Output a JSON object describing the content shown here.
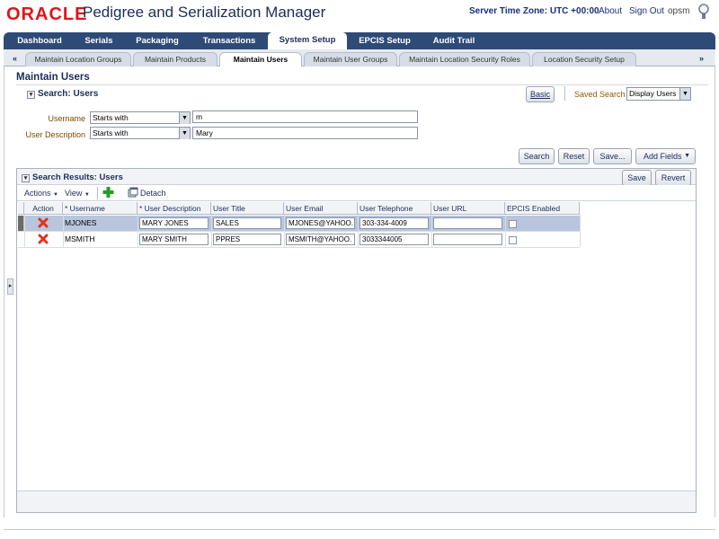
{
  "header": {
    "logo_text": "ORACLE",
    "app_title": "Pedigree and Serialization Manager",
    "server_time": "Server Time Zone: UTC +00:00",
    "about": "About",
    "sign_out": "Sign Out",
    "user": "opsm"
  },
  "main_tabs": [
    {
      "label": "Dashboard",
      "active": false
    },
    {
      "label": "Serials",
      "active": false
    },
    {
      "label": "Packaging",
      "active": false
    },
    {
      "label": "Transactions",
      "active": false
    },
    {
      "label": "System Setup",
      "active": true
    },
    {
      "label": "EPCIS Setup",
      "active": false
    },
    {
      "label": "Audit Trail",
      "active": false
    }
  ],
  "sub_tabs": {
    "left_arrow": "«",
    "right_arrow": "»",
    "items": [
      {
        "label": "Maintain Location Groups",
        "active": false
      },
      {
        "label": "Maintain Products",
        "active": false
      },
      {
        "label": "Maintain Users",
        "active": true
      },
      {
        "label": "Maintain User Groups",
        "active": false
      },
      {
        "label": "Maintain Location Security Roles",
        "active": false
      },
      {
        "label": "Location Security Setup",
        "active": false
      }
    ]
  },
  "page": {
    "title": "Maintain Users"
  },
  "search": {
    "header": "Search: Users",
    "basic_button": "Basic",
    "saved_search_label": "Saved Search",
    "saved_search_value": "Display Users",
    "username_label": "Username",
    "username_operator": "Starts with",
    "username_value": "m",
    "userdesc_label": "User Description",
    "userdesc_operator": "Starts with",
    "userdesc_value": "Mary",
    "search_button": "Search",
    "reset_button": "Reset",
    "save_button": "Save...",
    "add_fields_button": "Add Fields"
  },
  "results": {
    "header": "Search Results: Users",
    "save_button": "Save",
    "revert_button": "Revert",
    "actions_menu": "Actions",
    "view_menu": "View",
    "detach": "Detach",
    "columns": [
      "Action",
      "* Username",
      "* User Description",
      "User Title",
      "User Email",
      "User Telephone",
      "User URL",
      "EPCIS Enabled"
    ],
    "rows": [
      {
        "username": "MJONES",
        "description": "MARY JONES",
        "title": "SALES",
        "email": "MJONES@YAHOO.",
        "telephone": "303-334-4009",
        "url": "",
        "epcis": false,
        "selected": true
      },
      {
        "username": "MSMITH",
        "description": "MARY SMITH",
        "title": "PPRES",
        "email": "MSMITH@YAHOO.",
        "telephone": "3033344005",
        "url": "",
        "epcis": false,
        "selected": false
      }
    ]
  },
  "colors": {
    "tab_bar": "#2e4a77",
    "accent_red": "#e0151a",
    "title_blue": "#1c2d58",
    "selected_row": "#b9c5dc"
  }
}
